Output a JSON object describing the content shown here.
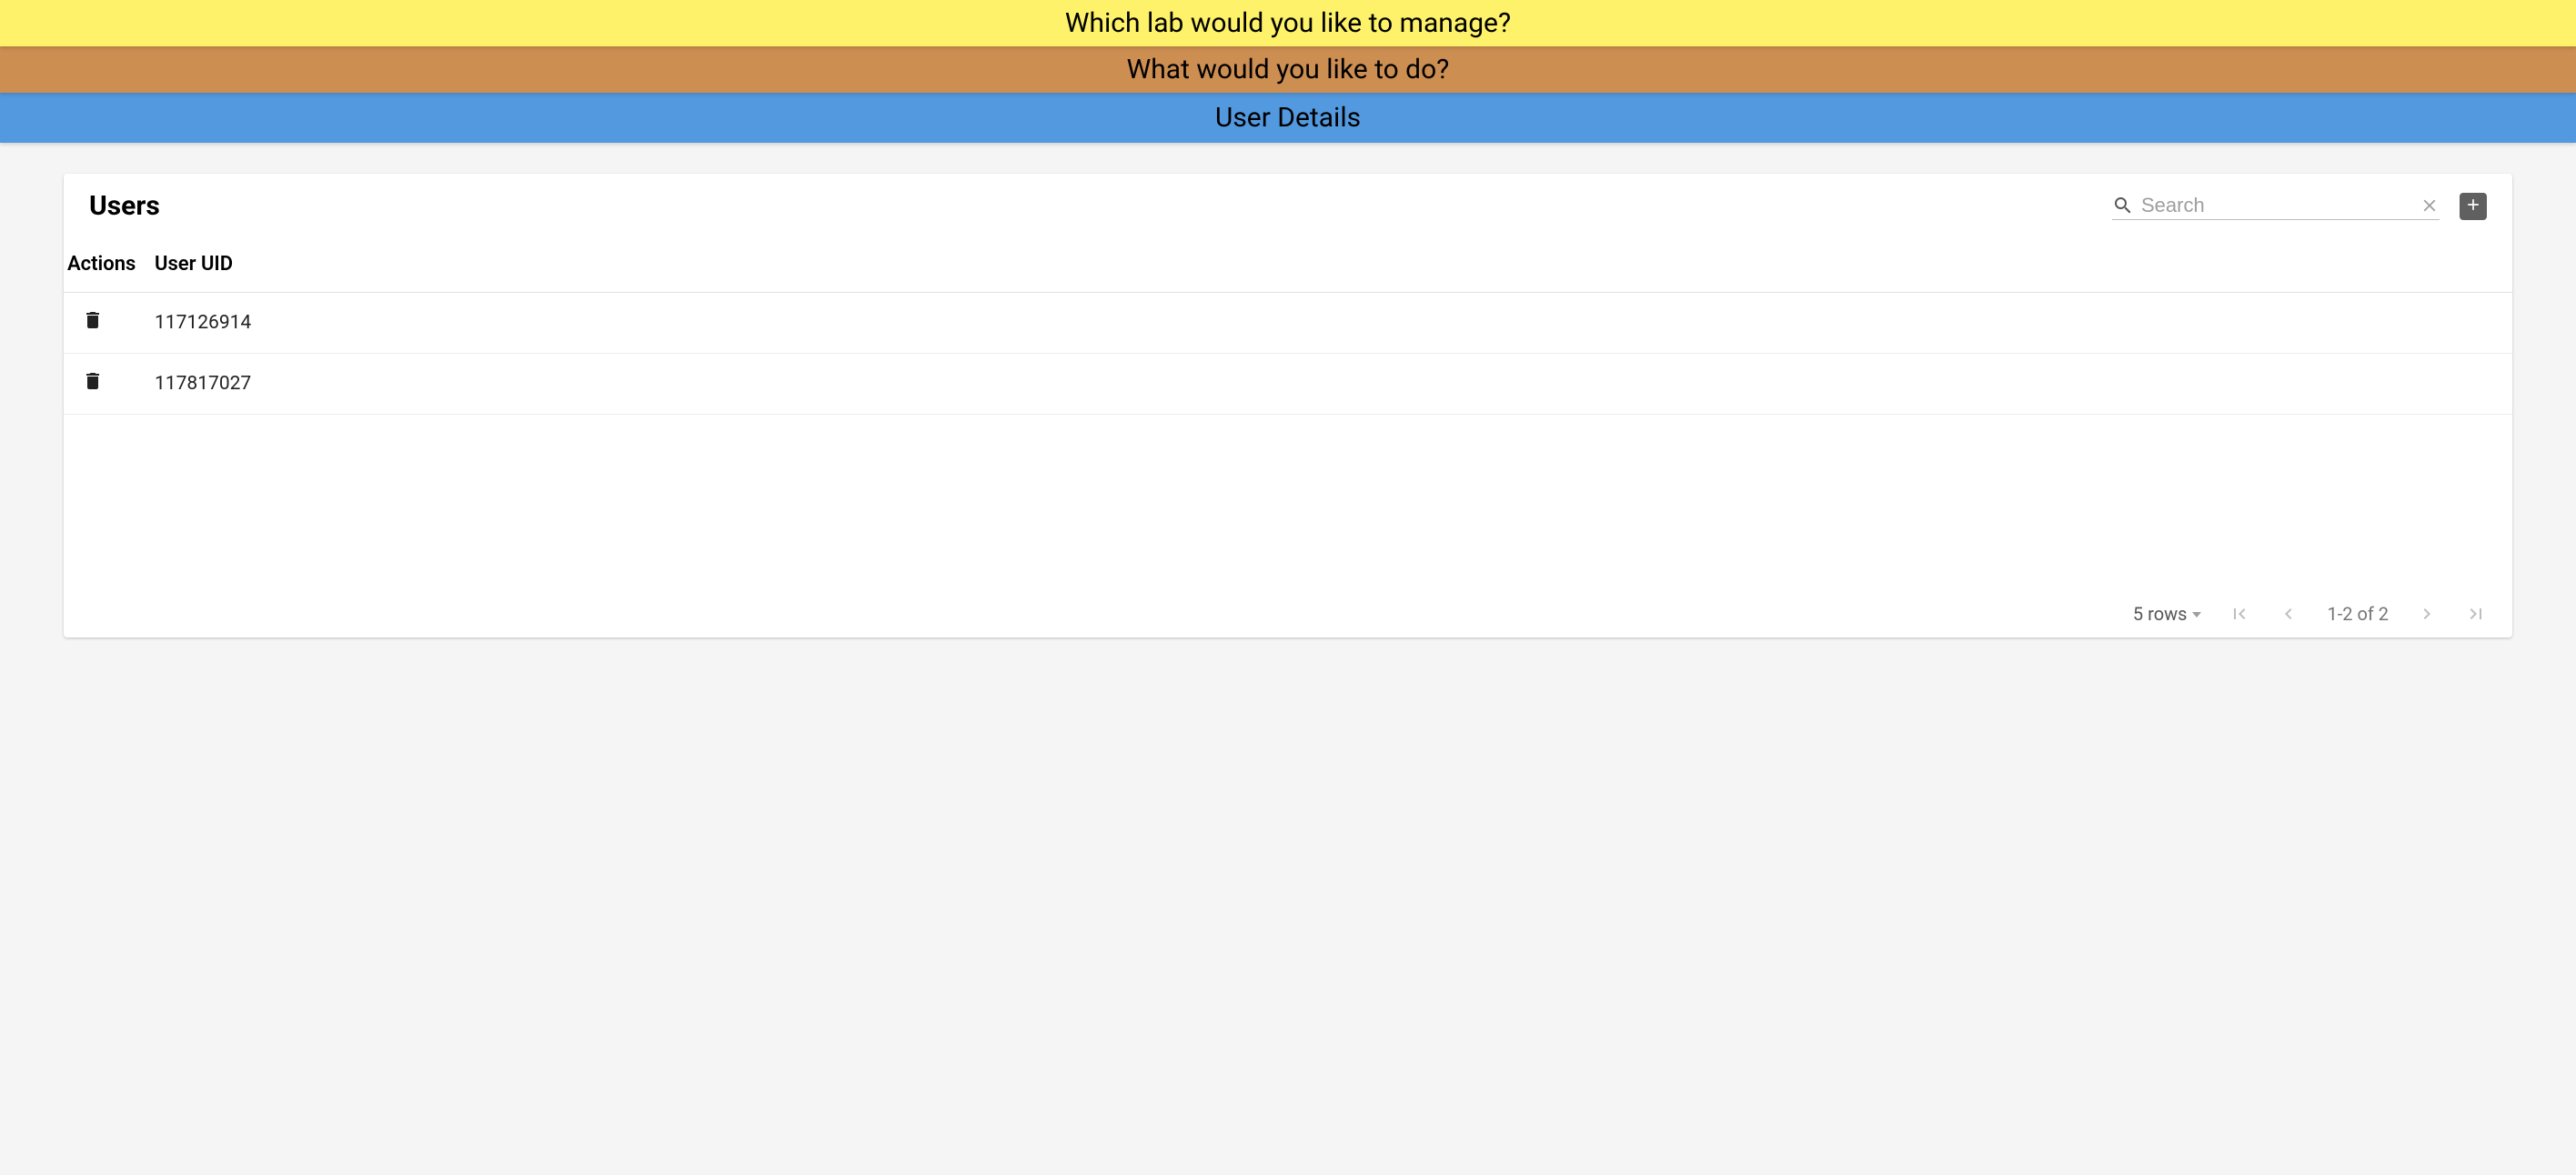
{
  "banners": {
    "lab": "Which lab would you like to manage?",
    "action": "What would you like to do?",
    "section": "User Details"
  },
  "card": {
    "title": "Users",
    "search_placeholder": "Search",
    "columns": {
      "actions": "Actions",
      "uid": "User UID"
    },
    "rows": [
      {
        "uid": "117126914"
      },
      {
        "uid": "117817027"
      }
    ],
    "footer": {
      "rows_label": "5 rows",
      "range": "1-2 of 2"
    }
  }
}
